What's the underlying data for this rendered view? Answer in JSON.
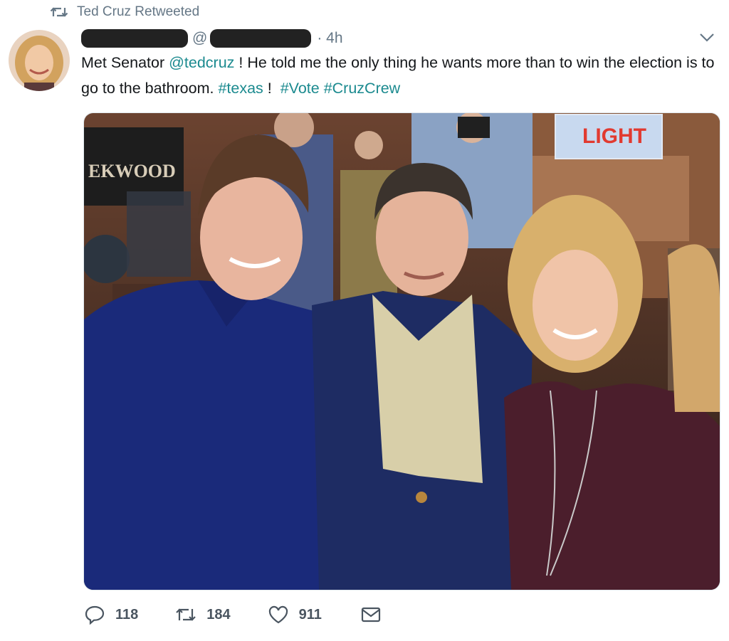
{
  "retweet_context": {
    "label": "Ted Cruz Retweeted",
    "icon": "retweet-icon"
  },
  "tweet": {
    "handle_prefix": "@",
    "timestamp": "· 4h",
    "text_parts": [
      {
        "text": "Met Senator ",
        "type": "plain"
      },
      {
        "text": "@tedcruz",
        "type": "link"
      },
      {
        "text": " ! He told me the only thing he wants more than to win the election is to go to the bathroom. ",
        "type": "plain"
      },
      {
        "text": "#texas",
        "type": "link"
      },
      {
        "text": " !  ",
        "type": "plain"
      },
      {
        "text": "#Vote",
        "type": "link"
      },
      {
        "text": " ",
        "type": "plain"
      },
      {
        "text": "#CruzCrew",
        "type": "link"
      }
    ],
    "photo_sign_text": "EKWOOD",
    "photo_neon_text": "LIGHT"
  },
  "actions": {
    "replies": "118",
    "retweets": "184",
    "likes": "911"
  },
  "colors": {
    "link": "#1b8a8f",
    "muted": "#657786"
  }
}
